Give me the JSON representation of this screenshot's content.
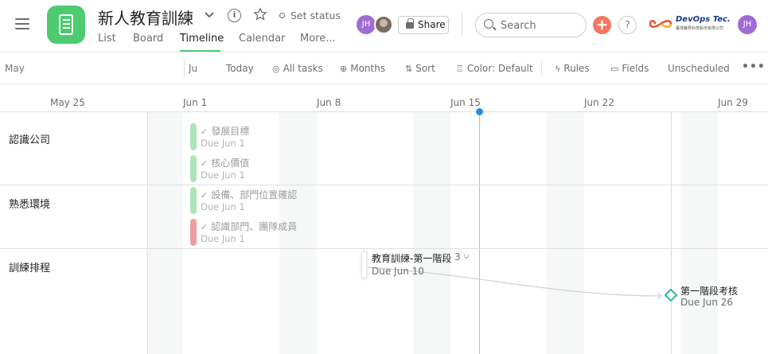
{
  "header": {
    "project_title": "新人教育訓練",
    "set_status": "Set status",
    "share_label": "Share",
    "search_placeholder": "Search",
    "help_label": "?",
    "add_label": "+",
    "brand_name": "DevOps Tec.",
    "brand_subtitle": "臺灣賽貝科技股份有限公司",
    "avatars": [
      "JH",
      "JH"
    ],
    "accent_color": "#4ecb71"
  },
  "tabs": [
    {
      "label": "List"
    },
    {
      "label": "Board"
    },
    {
      "label": "Timeline",
      "active": true
    },
    {
      "label": "Calendar"
    },
    {
      "label": "More..."
    }
  ],
  "toolbar": {
    "from_placeholder": "May",
    "to_placeholder": "Ju",
    "today": "Today",
    "all_tasks": "All tasks",
    "months": "Months",
    "sort": "Sort",
    "color": "Color: Default",
    "rules": "Rules",
    "fields": "Fields",
    "unscheduled": "Unscheduled",
    "more": "•••"
  },
  "timeline": {
    "weeks": [
      "May 25",
      "Jun 1",
      "Jun 8",
      "Jun 15",
      "Jun 22",
      "Jun 29"
    ],
    "sections": [
      {
        "label": "認識公司"
      },
      {
        "label": "熟悉環境"
      },
      {
        "label": "訓練排程"
      }
    ],
    "completed_tasks": [
      {
        "name": "發展目標",
        "due": "Due Jun 1",
        "color": "#aee5b8"
      },
      {
        "name": "核心價值",
        "due": "Due Jun 1",
        "color": "#aee5b8"
      },
      {
        "name": "設備、部門位置確認",
        "due": "Due Jun 1",
        "color": "#aee5b8"
      },
      {
        "name": "認識部門、團隊成員",
        "due": "Due Jun 1",
        "color": "#f09ca2"
      }
    ],
    "main_task": {
      "name": "教育訓練-第一階段",
      "subtasks": "3",
      "due": "Due Jun 10"
    },
    "milestone": {
      "name": "第一階段考核",
      "due": "Due Jun 26",
      "color": "#13b5a0"
    },
    "today_color": "#1f8ee5"
  }
}
